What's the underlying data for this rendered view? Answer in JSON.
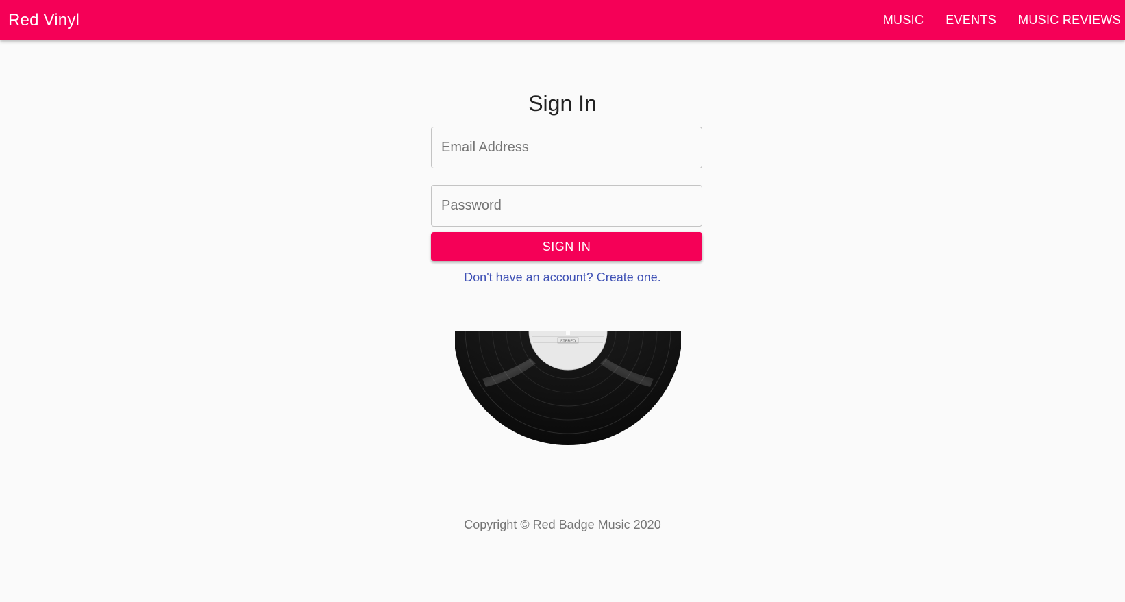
{
  "header": {
    "brand": "Red Vinyl",
    "nav": [
      {
        "label": "MUSIC"
      },
      {
        "label": "EVENTS"
      },
      {
        "label": "MUSIC REVIEWS"
      }
    ]
  },
  "signin": {
    "title": "Sign In",
    "email_placeholder": "Email Address",
    "password_placeholder": "Password",
    "button_label": "SIGN IN",
    "signup_link": "Don't have an account? Create one."
  },
  "image": {
    "label_text": "STEREO"
  },
  "footer": {
    "copyright": "Copyright © Red Badge Music 2020"
  },
  "colors": {
    "accent": "#f50057",
    "link": "#3f51b5",
    "background": "#fafafa"
  }
}
